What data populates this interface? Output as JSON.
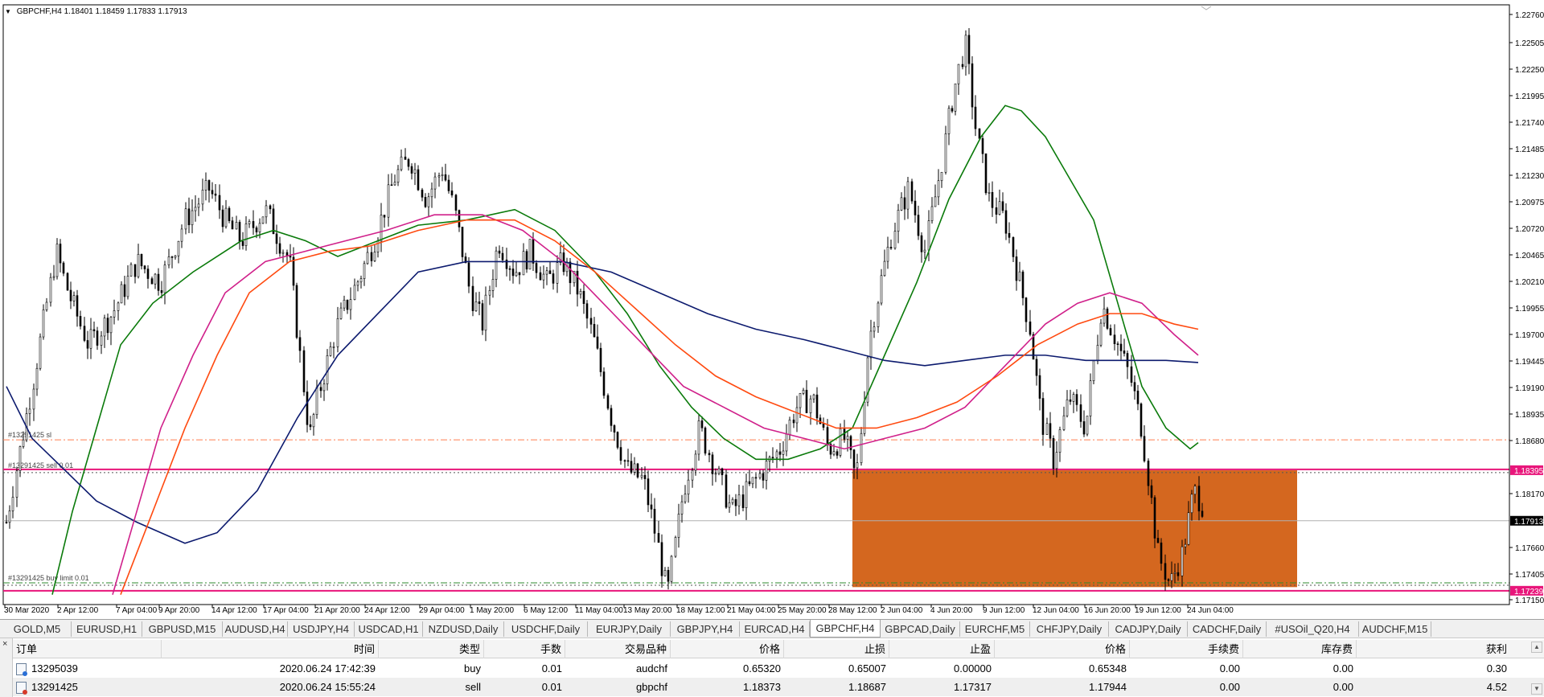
{
  "chart": {
    "title_symbol": "GBPCHF,H4",
    "title_ohlc": "1.18401 1.18459 1.17833 1.17913",
    "price_labels": [
      "1.22760",
      "1.22505",
      "1.22250",
      "1.21995",
      "1.21740",
      "1.21485",
      "1.21230",
      "1.20975",
      "1.20720",
      "1.20465",
      "1.20210",
      "1.19955",
      "1.19700",
      "1.19445",
      "1.19190",
      "1.18935",
      "1.18680",
      "1.18170",
      "1.17660",
      "1.17405",
      "1.17150"
    ],
    "price_current": "1.17913",
    "price_line_red": "1.18395",
    "price_line_bottom": "1.17239",
    "time_labels": [
      "30 Mar 2020",
      "2 Apr 12:00",
      "7 Apr 04:00",
      "9 Apr 20:00",
      "14 Apr 12:00",
      "17 Apr 04:00",
      "21 Apr 20:00",
      "24 Apr 12:00",
      "29 Apr 04:00",
      "1 May 20:00",
      "6 May 12:00",
      "11 May 04:00",
      "13 May 20:00",
      "18 May 12:00",
      "21 May 04:00",
      "25 May 20:00",
      "28 May 12:00",
      "2 Jun 04:00",
      "4 Jun 20:00",
      "9 Jun 12:00",
      "12 Jun 04:00",
      "16 Jun 20:00",
      "19 Jun 12:00",
      "24 Jun 04:00"
    ],
    "order_sl_label": "#13291425 sl",
    "order_sell_label": "#13291425 sell 0.01",
    "order_buylimit_label": "#13291425 buy limit 0.01",
    "colors": {
      "candles": "#000000",
      "ma_green": "#0a7a0a",
      "ma_navy": "#0c1a6e",
      "ma_magenta": "#d0208a",
      "ma_orange": "#ff4a10",
      "rect": "#d4671f",
      "red_line": "#e8157a",
      "sl_line": "#ff7f50",
      "buylimit_line": "#2e8b2e"
    }
  },
  "tabs": [
    "GOLD,M5",
    "EURUSD,H1",
    "GBPUSD,M15",
    "AUDUSD,H4",
    "USDJPY,H4",
    "USDCAD,H1",
    "NZDUSD,Daily",
    "USDCHF,Daily",
    "EURJPY,Daily",
    "GBPJPY,H4",
    "EURCAD,H4",
    "GBPCHF,H4",
    "GBPCAD,Daily",
    "EURCHF,M5",
    "CHFJPY,Daily",
    "CADJPY,Daily",
    "CADCHF,Daily",
    "#USOil_Q20,H4",
    "AUDCHF,M15"
  ],
  "active_tab": "GBPCHF,H4",
  "terminal": {
    "close_symbol": "×",
    "headers": [
      "订单",
      "时间",
      "类型",
      "手数",
      "交易品种",
      "价格",
      "止损",
      "止盈",
      "价格",
      "手续费",
      "库存费",
      "获利"
    ],
    "rows": [
      {
        "order": "13295039",
        "time": "2020.06.24 17:42:39",
        "type": "buy",
        "lots": "0.01",
        "symbol": "audchf",
        "price": "0.65320",
        "sl": "0.65007",
        "tp": "0.00000",
        "cur_price": "0.65348",
        "commission": "0.00",
        "swap": "0.00",
        "profit": "0.30",
        "icon": "buy-order-icon"
      },
      {
        "order": "13291425",
        "time": "2020.06.24 15:55:24",
        "type": "sell",
        "lots": "0.01",
        "symbol": "gbpchf",
        "price": "1.18373",
        "sl": "1.18687",
        "tp": "1.17317",
        "cur_price": "1.17944",
        "commission": "0.00",
        "swap": "0.00",
        "profit": "4.52",
        "icon": "sell-order-icon"
      }
    ]
  }
}
